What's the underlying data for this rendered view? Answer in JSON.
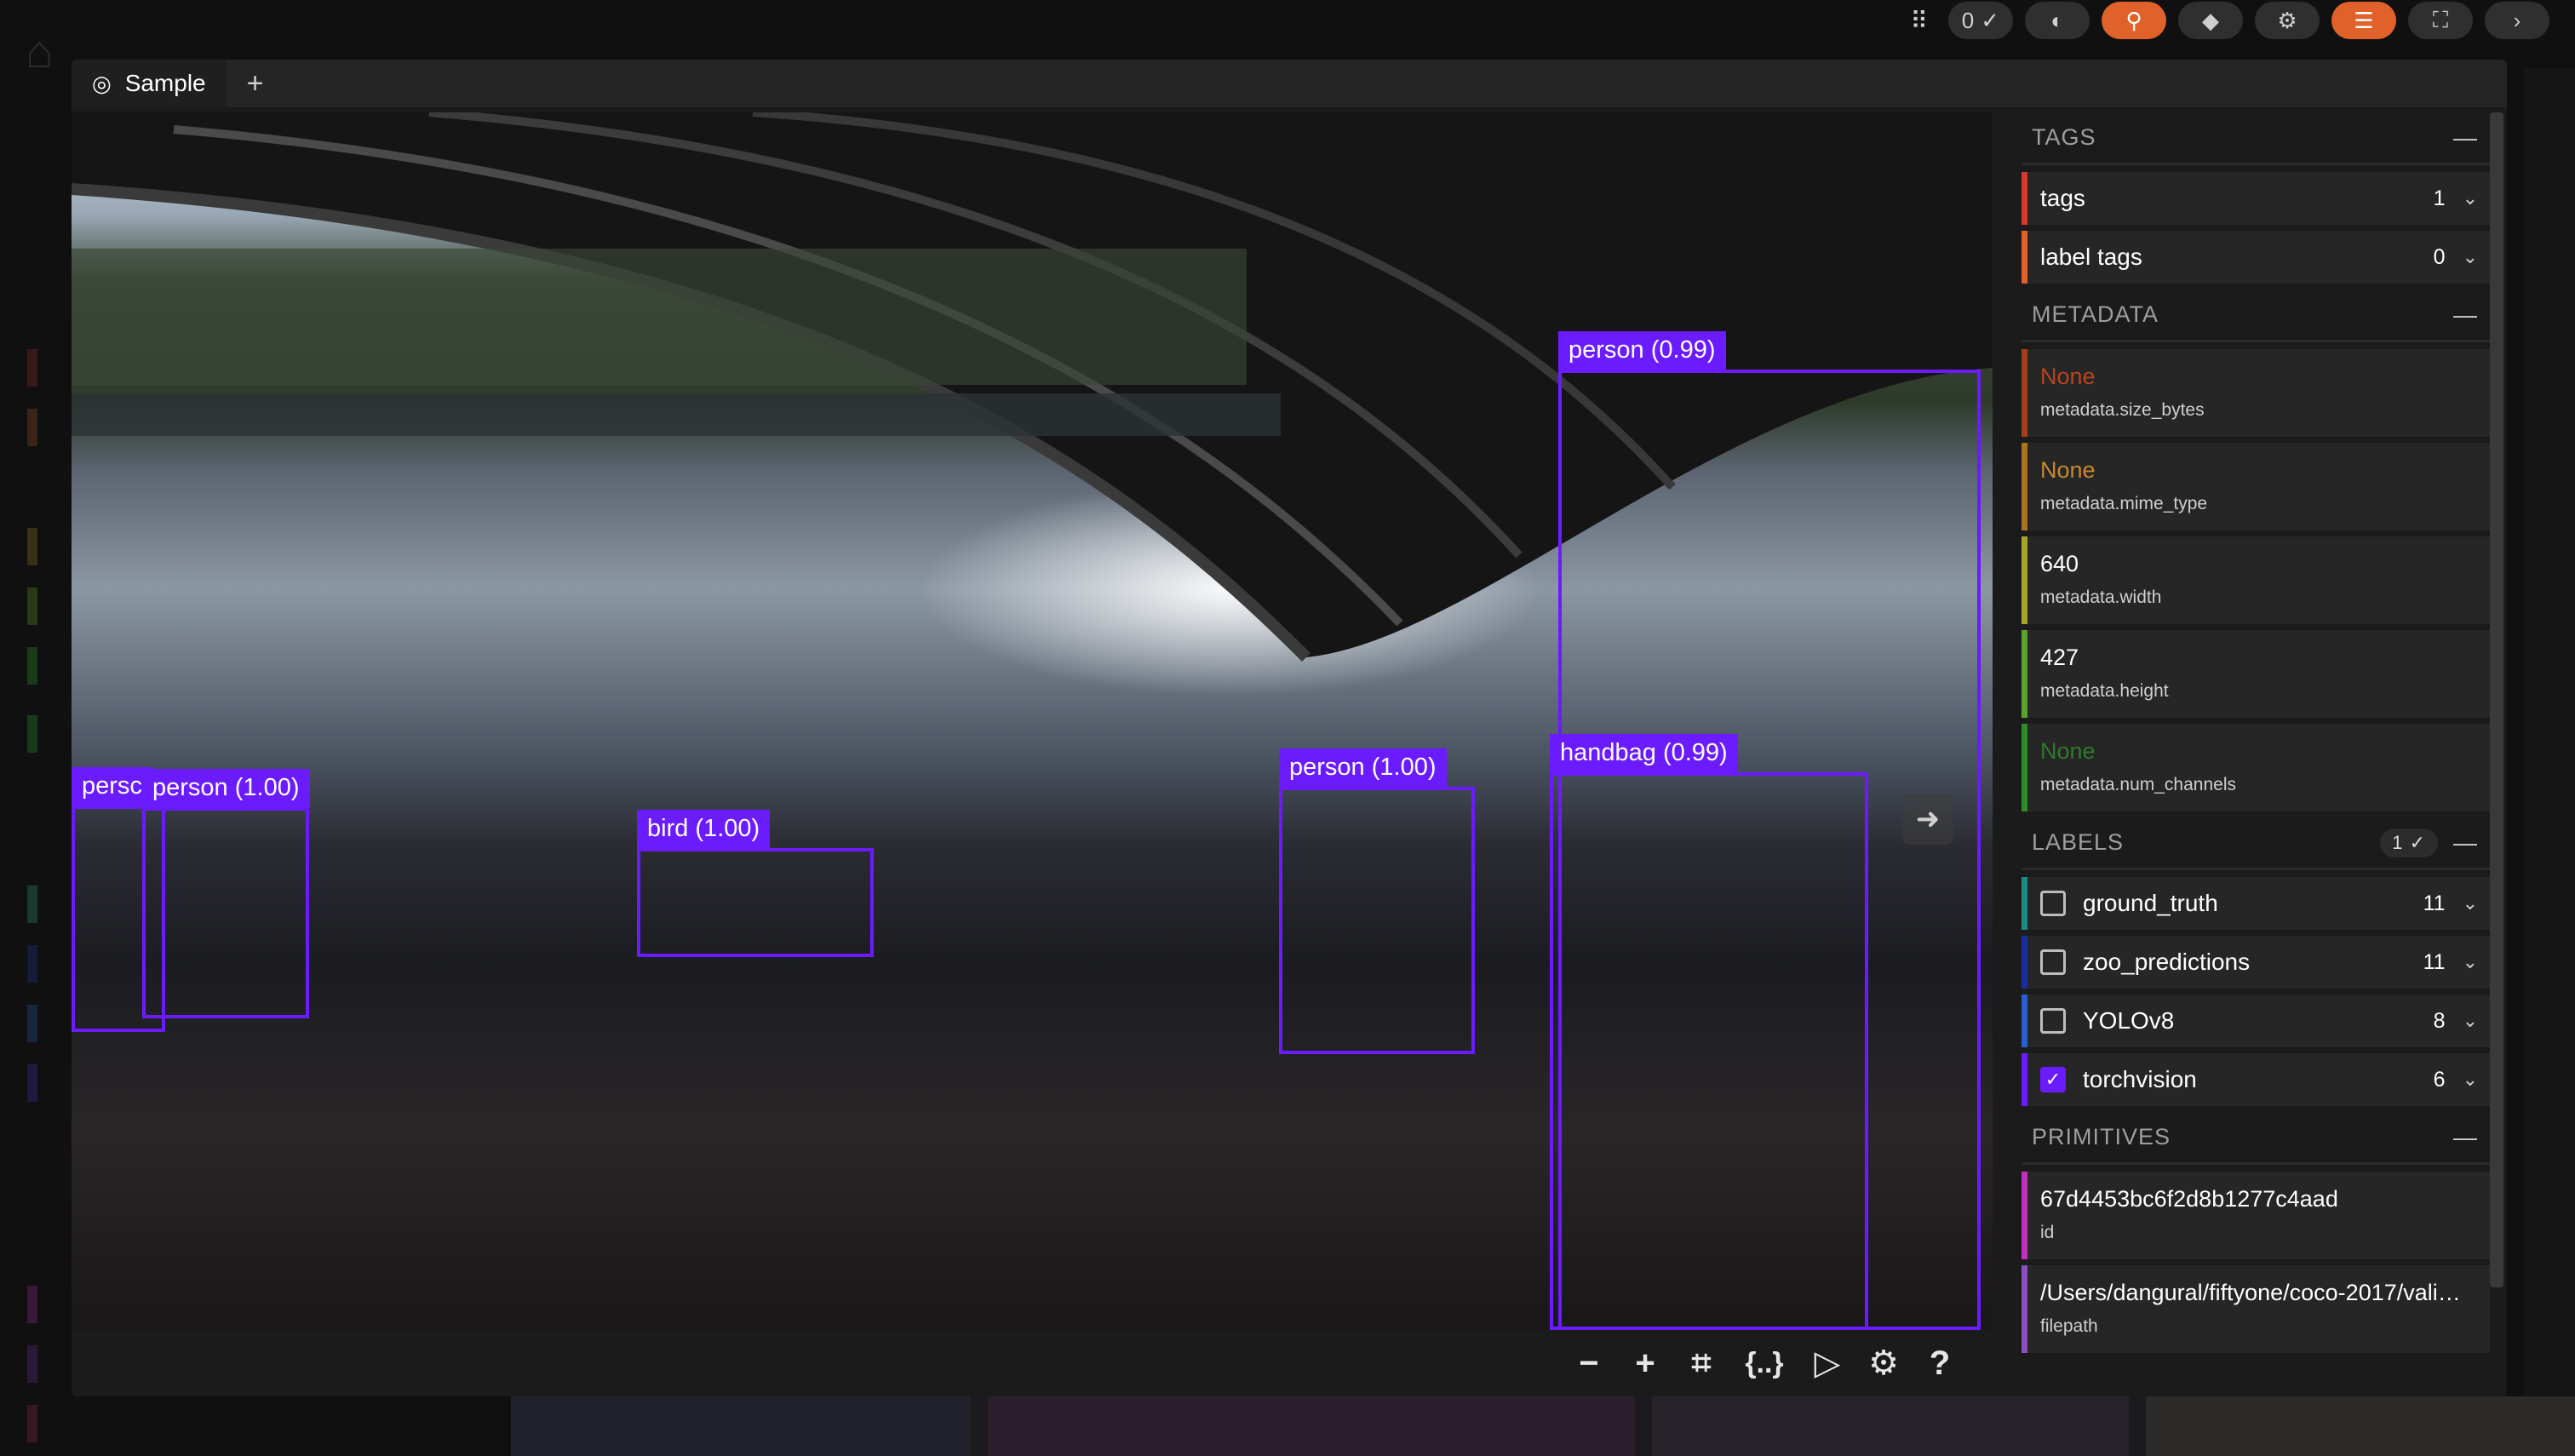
{
  "toolbar": {
    "count": "0",
    "count_icon": "checkmark-icon",
    "buttons": [
      "grid-dots-icon",
      "palette-icon",
      "search-icon",
      "tag-icon",
      "gear-icon",
      "list-icon",
      "fullscreen-icon",
      "chevron-right-icon"
    ],
    "accent": "#e0622a"
  },
  "tab": {
    "label": "Sample",
    "add": "+"
  },
  "viewer": {
    "detections": [
      {
        "label": "person (0.99)"
      },
      {
        "label": "handbag (0.99)"
      },
      {
        "label": "person (1.00)"
      },
      {
        "label": "bird (1.00)"
      },
      {
        "label": "person (1.00)"
      },
      {
        "label": "persc"
      }
    ],
    "box_color": "#6b1cff"
  },
  "sidebar": {
    "tags": {
      "header": "TAGS",
      "rows": [
        {
          "name": "tags",
          "count": "1",
          "color": "#d9382c"
        },
        {
          "name": "label tags",
          "count": "0",
          "color": "#e0622a"
        }
      ]
    },
    "metadata": {
      "header": "METADATA",
      "rows": [
        {
          "value": "None",
          "key": "metadata.size_bytes",
          "color": "#a0401c",
          "value_color": "#b9441e"
        },
        {
          "value": "None",
          "key": "metadata.mime_type",
          "color": "#a9731f",
          "value_color": "#c98a2a"
        },
        {
          "value": "640",
          "key": "metadata.width",
          "color": "#a7a32b",
          "value_color": "#ffffff"
        },
        {
          "value": "427",
          "key": "metadata.height",
          "color": "#5ea02c",
          "value_color": "#ffffff"
        },
        {
          "value": "None",
          "key": "metadata.num_channels",
          "color": "#2f8a2a",
          "value_color": "#2f7a2a"
        }
      ]
    },
    "labels": {
      "header": "LABELS",
      "selected": "1",
      "rows": [
        {
          "name": "ground_truth",
          "count": "11",
          "color": "#1f8a86",
          "checked": false
        },
        {
          "name": "zoo_predictions",
          "count": "11",
          "color": "#1a2d9a",
          "checked": false
        },
        {
          "name": "YOLOv8",
          "count": "8",
          "color": "#2a5fd0",
          "checked": false
        },
        {
          "name": "torchvision",
          "count": "6",
          "color": "#6b1cff",
          "checked": true
        }
      ]
    },
    "primitives": {
      "header": "PRIMITIVES",
      "rows": [
        {
          "value": "67d4453bc6f2d8b1277c4aad",
          "key": "id",
          "color": "#c030b8"
        },
        {
          "value": "/Users/dangural/fiftyone/coco-2017/vali…",
          "key": "filepath",
          "color": "#8a4fc0"
        }
      ]
    }
  }
}
